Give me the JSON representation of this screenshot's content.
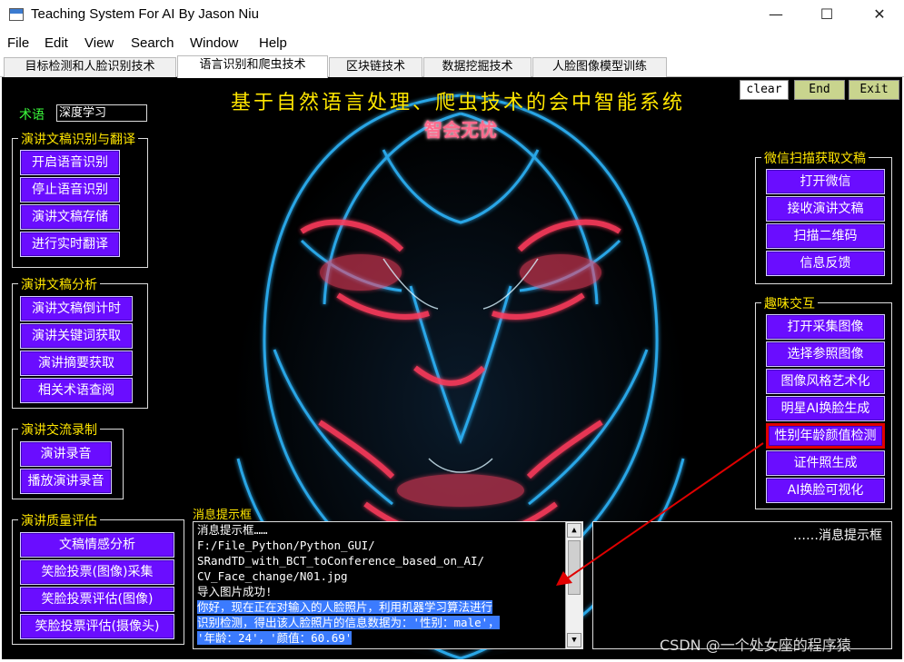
{
  "window": {
    "title": "Teaching System For AI By Jason Niu",
    "minimize": "—",
    "maximize": "☐",
    "close": "✕"
  },
  "menu": [
    "File",
    "Edit",
    "View",
    "Search",
    "Window",
    "Help"
  ],
  "tabs": [
    "目标检测和人脸识别技术",
    "语言识别和爬虫技术",
    "区块链技术",
    "数据挖掘技术",
    "人脸图像模型训练"
  ],
  "header": {
    "title": "基于自然语言处理、爬虫技术的会中智能系统",
    "subtitle": "智会无忧"
  },
  "term": {
    "label": "术语",
    "value": "深度学习"
  },
  "top_buttons": {
    "clear": "clear",
    "end": "End",
    "exit": "Exit"
  },
  "groups": {
    "speech": {
      "title": "演讲文稿识别与翻译",
      "buttons": [
        "开启语音识别",
        "停止语音识别",
        "演讲文稿存储",
        "进行实时翻译"
      ]
    },
    "analysis": {
      "title": "演讲文稿分析",
      "buttons": [
        "演讲文稿倒计时",
        "演讲关键词获取",
        "演讲摘要获取",
        "相关术语查阅"
      ]
    },
    "record": {
      "title": "演讲交流录制",
      "buttons": [
        "演讲录音",
        "播放演讲录音"
      ]
    },
    "quality": {
      "title": "演讲质量评估",
      "buttons": [
        "文稿情感分析",
        "笑脸投票(图像)采集",
        "笑脸投票评估(图像)",
        "笑脸投票评估(摄像头)"
      ]
    },
    "wechat": {
      "title": "微信扫描获取文稿",
      "buttons": [
        "打开微信",
        "接收演讲文稿",
        "扫描二维码",
        "信息反馈"
      ]
    },
    "fun": {
      "title": "趣味交互",
      "buttons": [
        "打开采集图像",
        "选择参照图像",
        "图像风格艺术化",
        "明星AI换脸生成",
        "性别年龄颜值检测",
        "证件照生成",
        "AI换脸可视化"
      ]
    }
  },
  "message": {
    "label": "消息提示框",
    "lines": [
      "消息提示框……",
      "F:/File_Python/Python_GUI/",
      "SRandTD_with_BCT_toConference_based_on_AI/",
      "CV_Face_change/N01.jpg",
      "导入图片成功!"
    ],
    "selected_lines": [
      "你好，现在正在对输入的人脸照片，利用机器学习算法进行",
      "识别检测，得出该人脸照片的信息数据为：'性别：male'，",
      "'年龄：24'，'颜值：60.69'"
    ]
  },
  "right_message": {
    "label": "……消息提示框"
  },
  "watermark": "CSDN @一个处女座的程序猿",
  "colors": {
    "accent": "#6a0dff",
    "highlight": "#e00000",
    "heading": "#ffe600"
  }
}
